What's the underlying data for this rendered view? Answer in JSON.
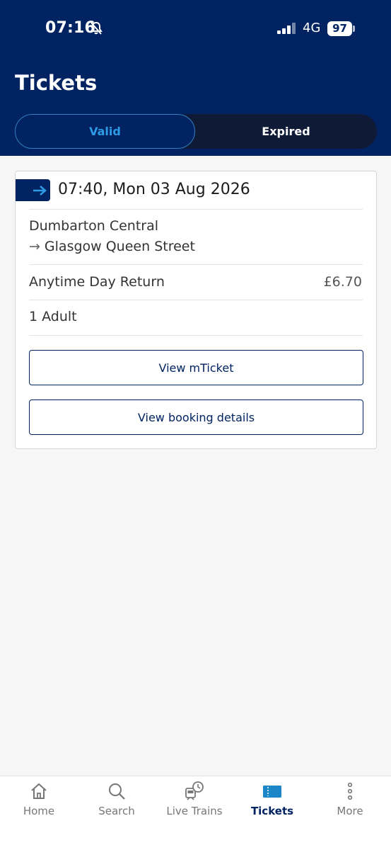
{
  "status_bar": {
    "time": "07:16",
    "network": "4G",
    "battery": "97"
  },
  "header": {
    "title": "Tickets",
    "tabs": [
      {
        "label": "Valid",
        "active": true
      },
      {
        "label": "Expired",
        "active": false
      }
    ]
  },
  "ticket": {
    "datetime": "07:40, Mon 03 Aug 2026",
    "origin": "Dumbarton Central",
    "destination": "Glasgow Queen Street",
    "route_arrow": "→",
    "fare_type": "Anytime Day Return",
    "price": "£6.70",
    "passengers": "1 Adult",
    "view_mticket_label": "View mTicket",
    "view_booking_label": "View booking details"
  },
  "bottom_nav": {
    "items": [
      {
        "label": "Home",
        "icon": "home-icon"
      },
      {
        "label": "Search",
        "icon": "search-icon"
      },
      {
        "label": "Live Trains",
        "icon": "live-trains-icon"
      },
      {
        "label": "Tickets",
        "icon": "ticket-icon",
        "active": true
      },
      {
        "label": "More",
        "icon": "more-icon"
      }
    ]
  },
  "colors": {
    "brand_navy": "#012362",
    "accent_blue": "#2e9be6",
    "background": "#f6f6f6"
  }
}
